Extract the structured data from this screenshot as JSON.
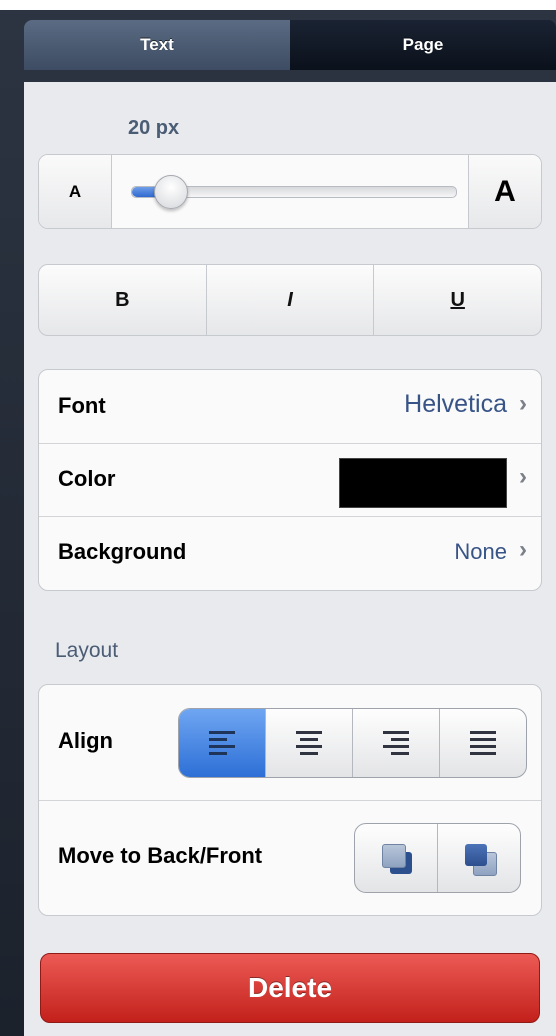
{
  "tabs": [
    {
      "label": "Text",
      "selected": true
    },
    {
      "label": "Page",
      "selected": false
    }
  ],
  "font_size": {
    "label": "20 px",
    "small_label": "A",
    "large_label": "A",
    "slider_value_fraction": 0.12
  },
  "text_style": {
    "bold": "B",
    "italic": "I",
    "underline": "U"
  },
  "properties": {
    "font": {
      "label": "Font",
      "value": "Helvetica"
    },
    "color": {
      "label": "Color",
      "value_color": "#000000"
    },
    "background": {
      "label": "Background",
      "value": "None"
    }
  },
  "layout": {
    "title": "Layout",
    "align": {
      "label": "Align",
      "options": [
        "align-left-icon",
        "align-center-icon",
        "align-right-icon",
        "align-justify-icon"
      ],
      "selected_index": 0
    },
    "order": {
      "label": "Move to Back/Front",
      "options": [
        "send-to-back-icon",
        "bring-to-front-icon"
      ]
    }
  },
  "delete_label": "Delete",
  "colors": {
    "accent_blue": "#2d6fd6",
    "delete_red": "#c3211b",
    "label_blue": "#385487"
  }
}
